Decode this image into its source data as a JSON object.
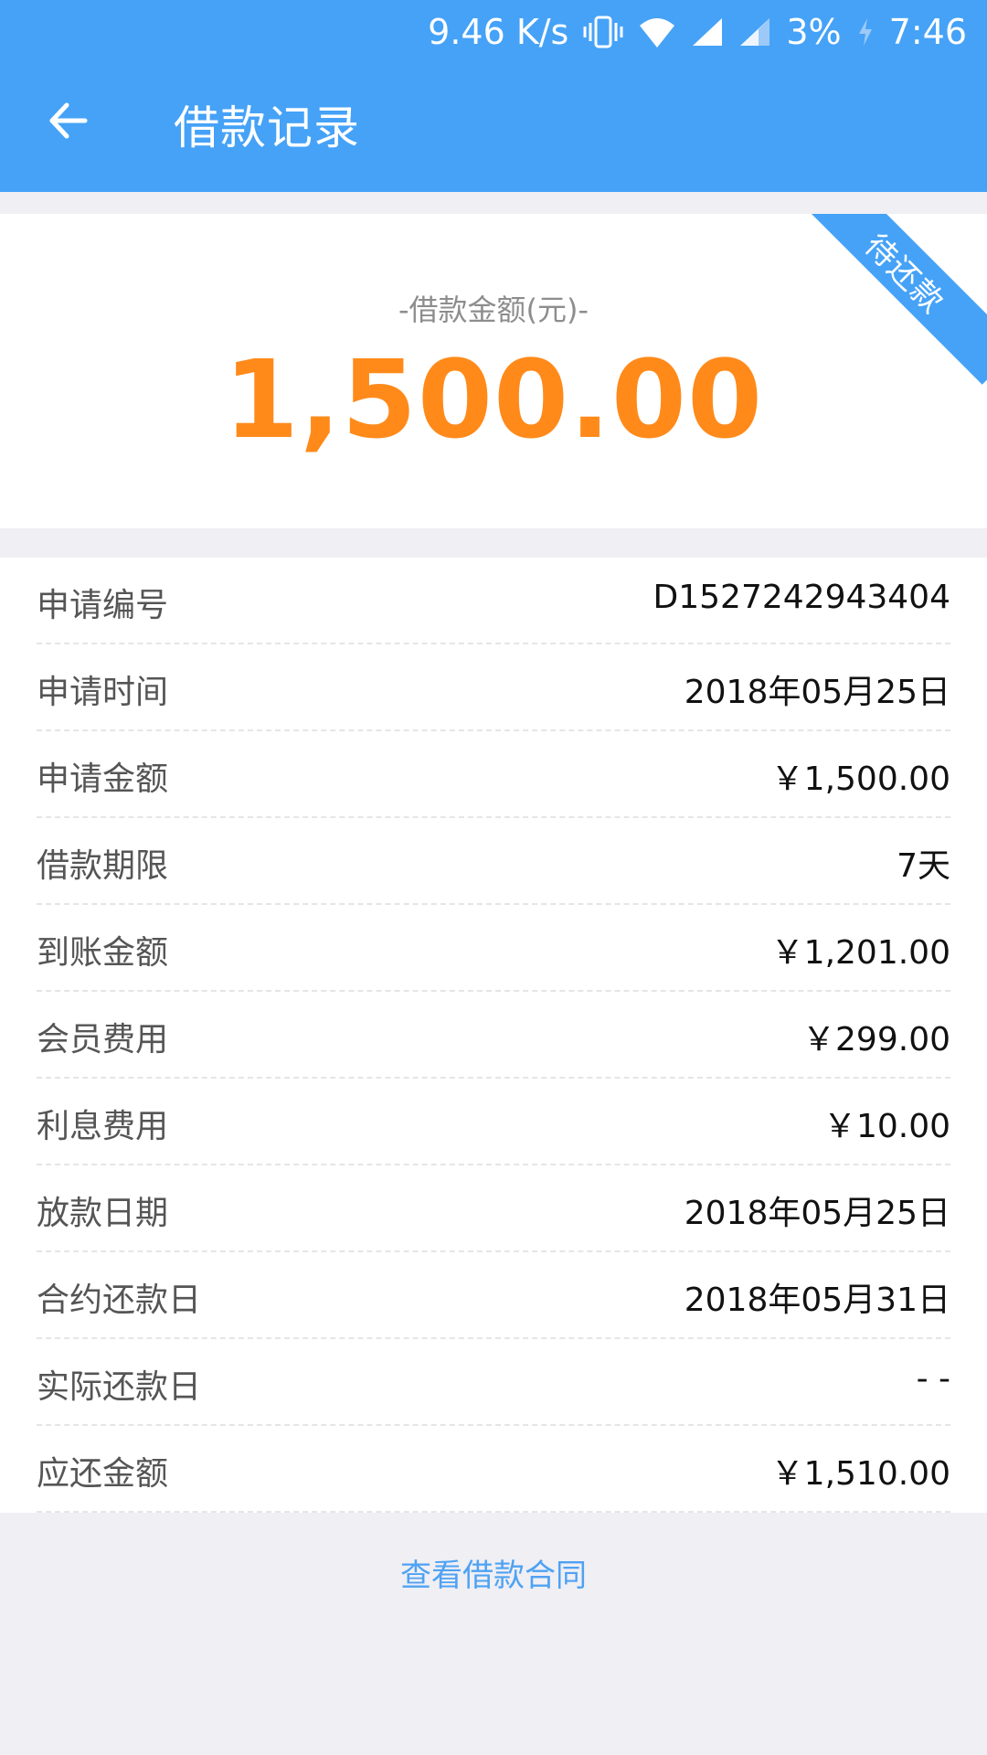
{
  "status_bar": {
    "network_speed": "9.46 K/s",
    "battery": "3%",
    "time": "7:46",
    "icons": [
      "vibrate-icon",
      "wifi-icon",
      "signal-icon",
      "signal-icon",
      "charging-icon"
    ]
  },
  "header": {
    "title": "借款记录"
  },
  "amount_card": {
    "caption": "-借款金额(元)-",
    "amount": "1,500.00",
    "ribbon_label": "待还款"
  },
  "details": [
    {
      "label": "申请编号",
      "value": "D1527242943404"
    },
    {
      "label": "申请时间",
      "value": "2018年05月25日"
    },
    {
      "label": "申请金额",
      "value": "￥1,500.00"
    },
    {
      "label": "借款期限",
      "value": "7天"
    },
    {
      "label": "到账金额",
      "value": "￥1,201.00"
    },
    {
      "label": "会员费用",
      "value": "￥299.00"
    },
    {
      "label": "利息费用",
      "value": "￥10.00"
    },
    {
      "label": "放款日期",
      "value": "2018年05月25日"
    },
    {
      "label": "合约还款日",
      "value": "2018年05月31日"
    },
    {
      "label": "实际还款日",
      "value": "- -"
    },
    {
      "label": "应还金额",
      "value": "￥1,510.00"
    }
  ],
  "footer": {
    "contract_link": "查看借款合同"
  },
  "colors": {
    "primary": "#45a2f7",
    "amount": "#ff8a1a",
    "link": "#4fa2f3",
    "background": "#efeff4"
  }
}
